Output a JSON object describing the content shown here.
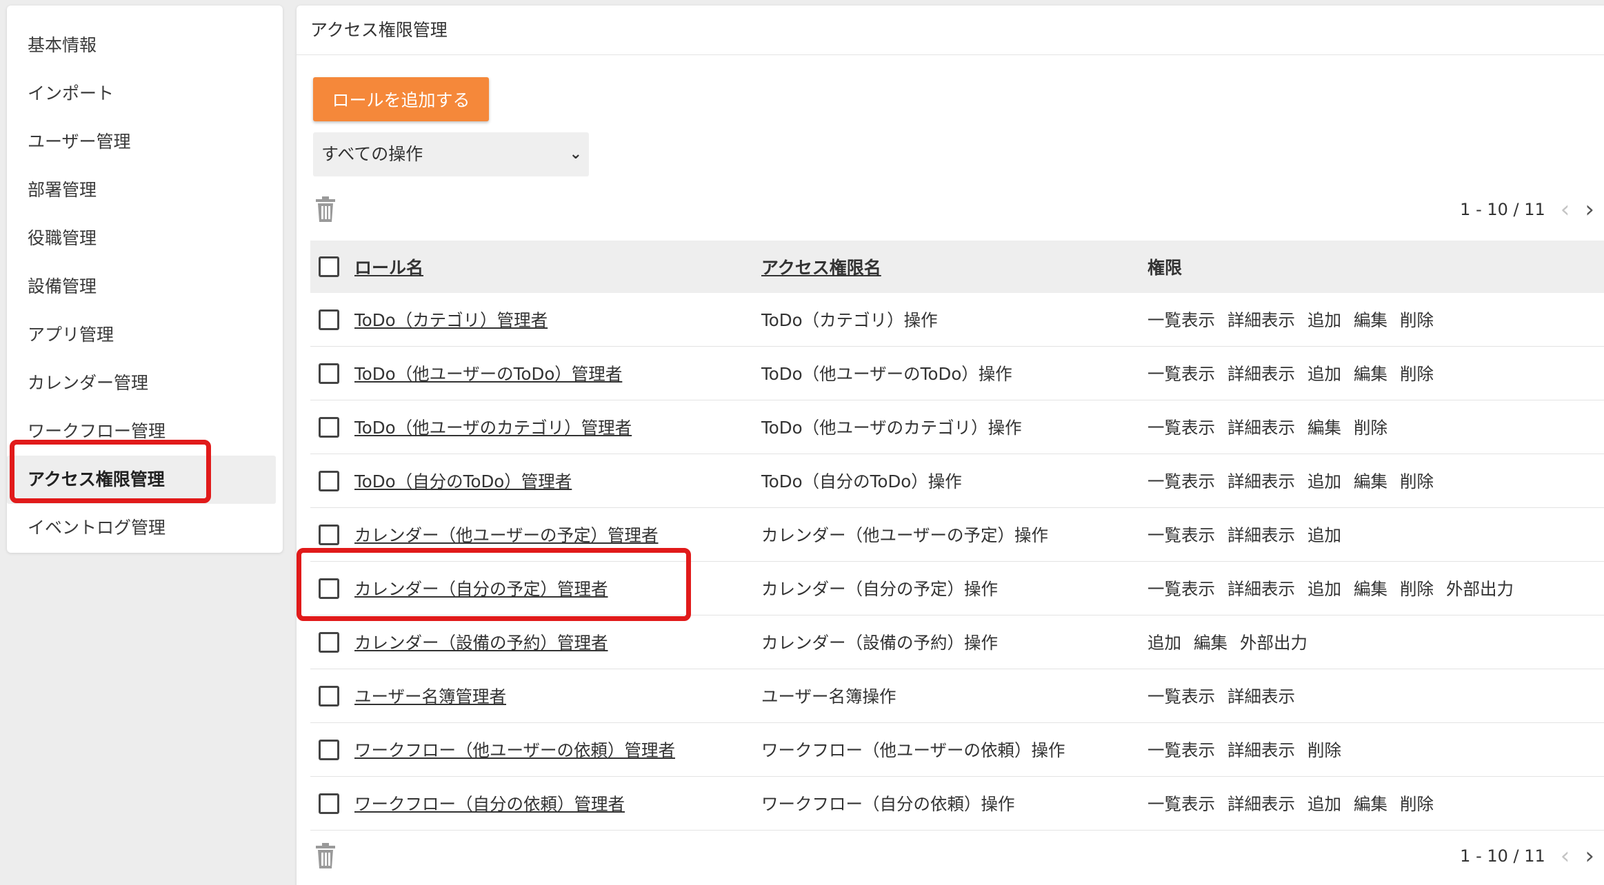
{
  "sidebar": {
    "items": [
      {
        "label": "基本情報"
      },
      {
        "label": "インポート"
      },
      {
        "label": "ユーザー管理"
      },
      {
        "label": "部署管理"
      },
      {
        "label": "役職管理"
      },
      {
        "label": "設備管理"
      },
      {
        "label": "アプリ管理"
      },
      {
        "label": "カレンダー管理"
      },
      {
        "label": "ワークフロー管理"
      },
      {
        "label": "アクセス権限管理"
      },
      {
        "label": "イベントログ管理"
      }
    ],
    "active_index": 9
  },
  "main": {
    "title": "アクセス権限管理",
    "add_button": "ロールを追加する",
    "filter": {
      "selected": "すべての操作"
    },
    "pager": {
      "range": "1 - 10 / 11"
    },
    "table": {
      "headers": {
        "role": "ロール名",
        "access": "アクセス権限名",
        "perm": "権限"
      },
      "rows": [
        {
          "role": "ToDo（カテゴリ）管理者",
          "access": "ToDo（カテゴリ）操作",
          "perms": [
            "一覧表示",
            "詳細表示",
            "追加",
            "編集",
            "削除"
          ]
        },
        {
          "role": "ToDo（他ユーザーのToDo）管理者",
          "access": "ToDo（他ユーザーのToDo）操作",
          "perms": [
            "一覧表示",
            "詳細表示",
            "追加",
            "編集",
            "削除"
          ]
        },
        {
          "role": "ToDo（他ユーザのカテゴリ）管理者",
          "access": "ToDo（他ユーザのカテゴリ）操作",
          "perms": [
            "一覧表示",
            "詳細表示",
            "編集",
            "削除"
          ]
        },
        {
          "role": "ToDo（自分のToDo）管理者",
          "access": "ToDo（自分のToDo）操作",
          "perms": [
            "一覧表示",
            "詳細表示",
            "追加",
            "編集",
            "削除"
          ]
        },
        {
          "role": "カレンダー（他ユーザーの予定）管理者",
          "access": "カレンダー（他ユーザーの予定）操作",
          "perms": [
            "一覧表示",
            "詳細表示",
            "追加"
          ]
        },
        {
          "role": "カレンダー（自分の予定）管理者",
          "access": "カレンダー（自分の予定）操作",
          "perms": [
            "一覧表示",
            "詳細表示",
            "追加",
            "編集",
            "削除",
            "外部出力"
          ]
        },
        {
          "role": "カレンダー（設備の予約）管理者",
          "access": "カレンダー（設備の予約）操作",
          "perms": [
            "追加",
            "編集",
            "外部出力"
          ]
        },
        {
          "role": "ユーザー名簿管理者",
          "access": "ユーザー名簿操作",
          "perms": [
            "一覧表示",
            "詳細表示"
          ]
        },
        {
          "role": "ワークフロー（他ユーザーの依頼）管理者",
          "access": "ワークフロー（他ユーザーの依頼）操作",
          "perms": [
            "一覧表示",
            "詳細表示",
            "削除"
          ]
        },
        {
          "role": "ワークフロー（自分の依頼）管理者",
          "access": "ワークフロー（自分の依頼）操作",
          "perms": [
            "一覧表示",
            "詳細表示",
            "追加",
            "編集",
            "削除"
          ]
        }
      ]
    }
  },
  "colors": {
    "accent": "#f5883a",
    "highlight": "#e11a1a"
  },
  "icons": {
    "trash": "trash-icon",
    "select": "chevron-down-icon",
    "prev": "chevron-left-icon",
    "next": "chevron-right-icon"
  }
}
